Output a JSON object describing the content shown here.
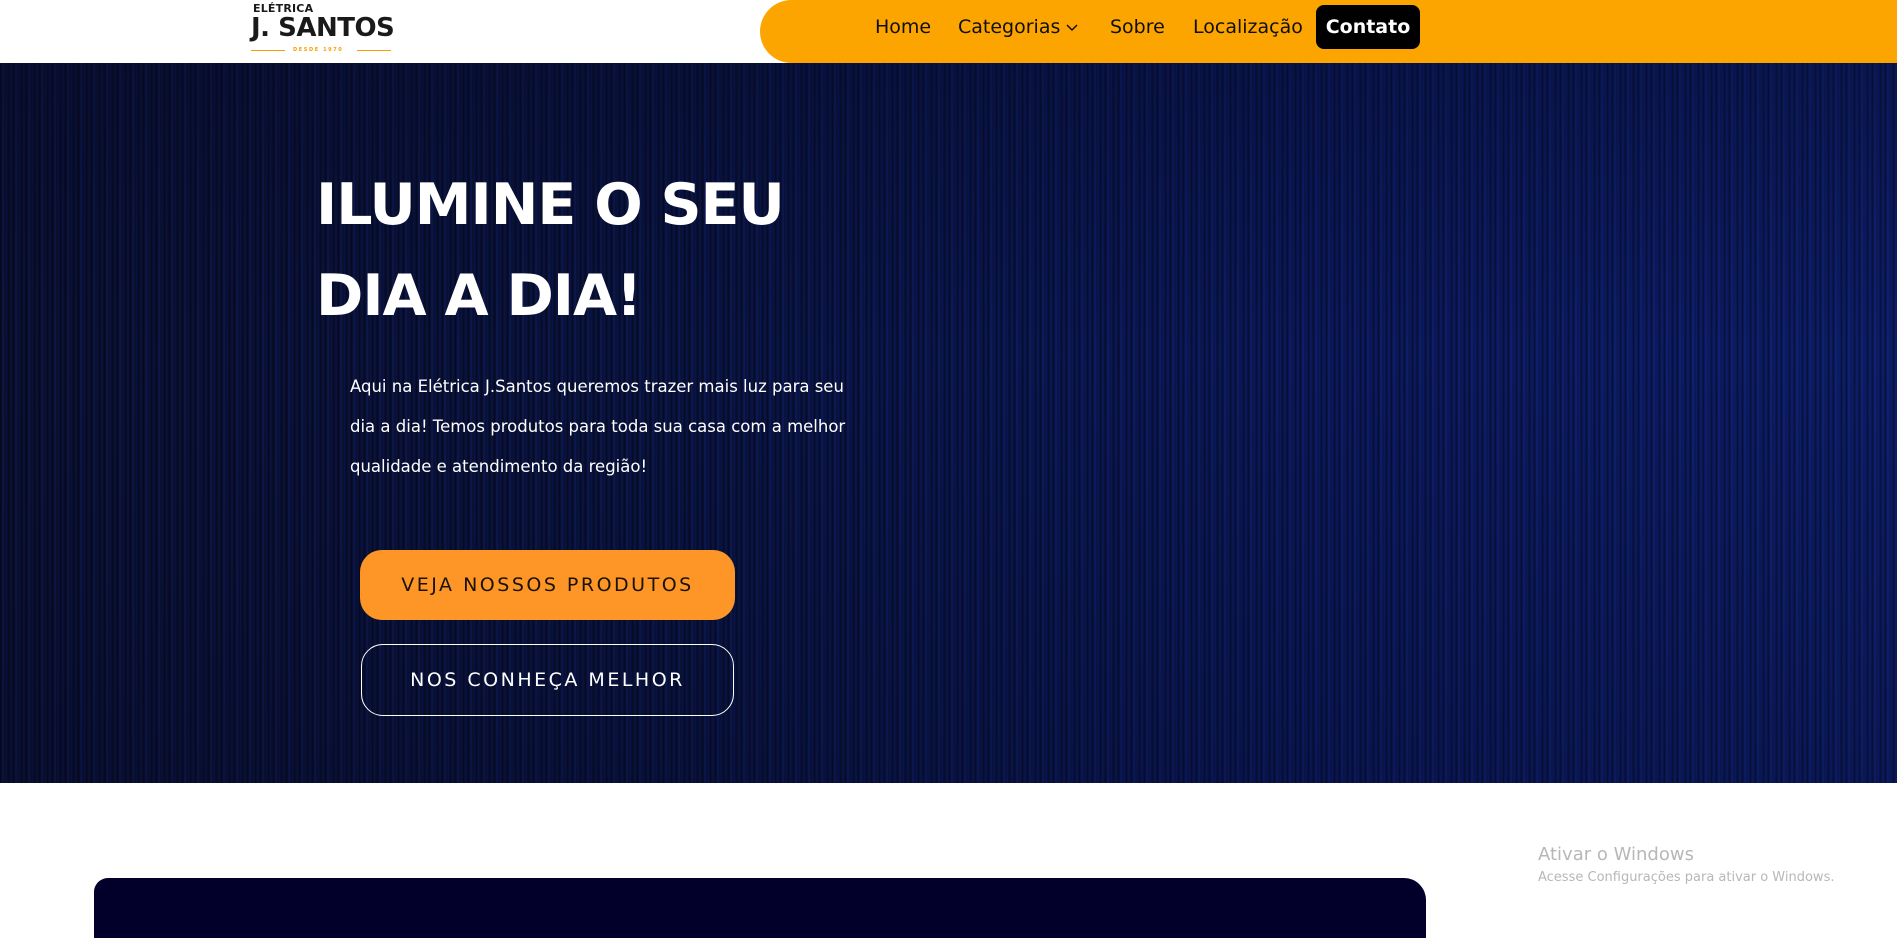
{
  "logo": {
    "top_text": "ELÉTRICA",
    "main_text": "J. SANTOS",
    "sub_text": "DESDE 1970"
  },
  "nav": {
    "items": [
      {
        "label": "Home"
      },
      {
        "label": "Categorias"
      },
      {
        "label": "Sobre"
      },
      {
        "label": "Localização"
      }
    ],
    "contact_label": "Contato"
  },
  "hero": {
    "title_line1": "ILUMINE O SEU",
    "title_line2": "DIA A DIA!",
    "description": "Aqui na Elétrica J.Santos queremos trazer mais luz para seu dia a dia! Temos produtos para toda sua casa com a melhor qualidade e atendimento da região!",
    "primary_button": "VEJA NOSSOS PRODUTOS",
    "secondary_button": "NOS CONHEÇA MELHOR"
  },
  "watermark": {
    "title": "Ativar o Windows",
    "subtitle": "Acesse Configurações para ativar o Windows."
  },
  "colors": {
    "nav_background": "#fca500",
    "primary_button": "#fd9626",
    "hero_background": "#0c1a60",
    "card_background": "#02002a"
  }
}
